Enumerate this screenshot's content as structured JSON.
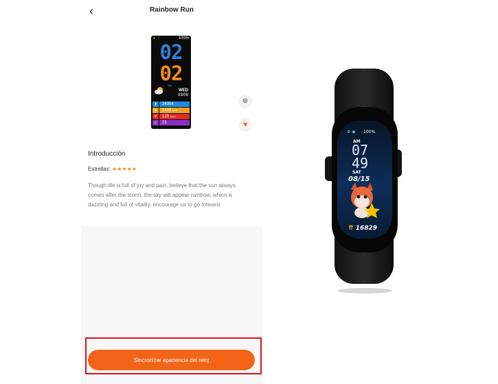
{
  "header": {
    "title": "Rainbow Run",
    "back_icon": "chevron-left-icon"
  },
  "preview": {
    "battery": "100%",
    "hour": "02",
    "minute": "02",
    "ampm": "AM",
    "weekday": "WED",
    "date": "03/09",
    "rows": [
      {
        "icon": "steps-icon",
        "value": "24354",
        "unit": "",
        "color": "#1f8ae0"
      },
      {
        "icon": "flame-icon",
        "value": "1435",
        "unit": "kcal",
        "color": "#f0a21b"
      },
      {
        "icon": "heart-rate-icon",
        "value": "123",
        "unit": "bpm",
        "color": "#e32a2a"
      },
      {
        "icon": "battery-icon",
        "value": "21",
        "unit": "",
        "color": "#8c2fc4"
      }
    ]
  },
  "actions": {
    "zoom_icon": "zoom-in-icon",
    "favorite_icon": "heart-icon"
  },
  "intro": {
    "heading": "Introducción",
    "stars_label": "Estrellas:",
    "stars": "★★★★★",
    "description": "Though life is full of joy and pain, believe that the sun always comes after the storm, the sky will appear rainbow, whicn is dazzling and full of vitality, encourage us to go forward."
  },
  "footer": {
    "sync_label": "Sincronizar apariencia del reloj"
  },
  "band_photo": {
    "time_hour": "07",
    "time_minute": "49",
    "ampm": "AM",
    "weekday": "SAT",
    "date": "08/15",
    "battery": "100%",
    "steps": "16829"
  },
  "colors": {
    "accent": "#f26418",
    "highlight_border": "#d8141e",
    "star": "#f08a1b"
  }
}
